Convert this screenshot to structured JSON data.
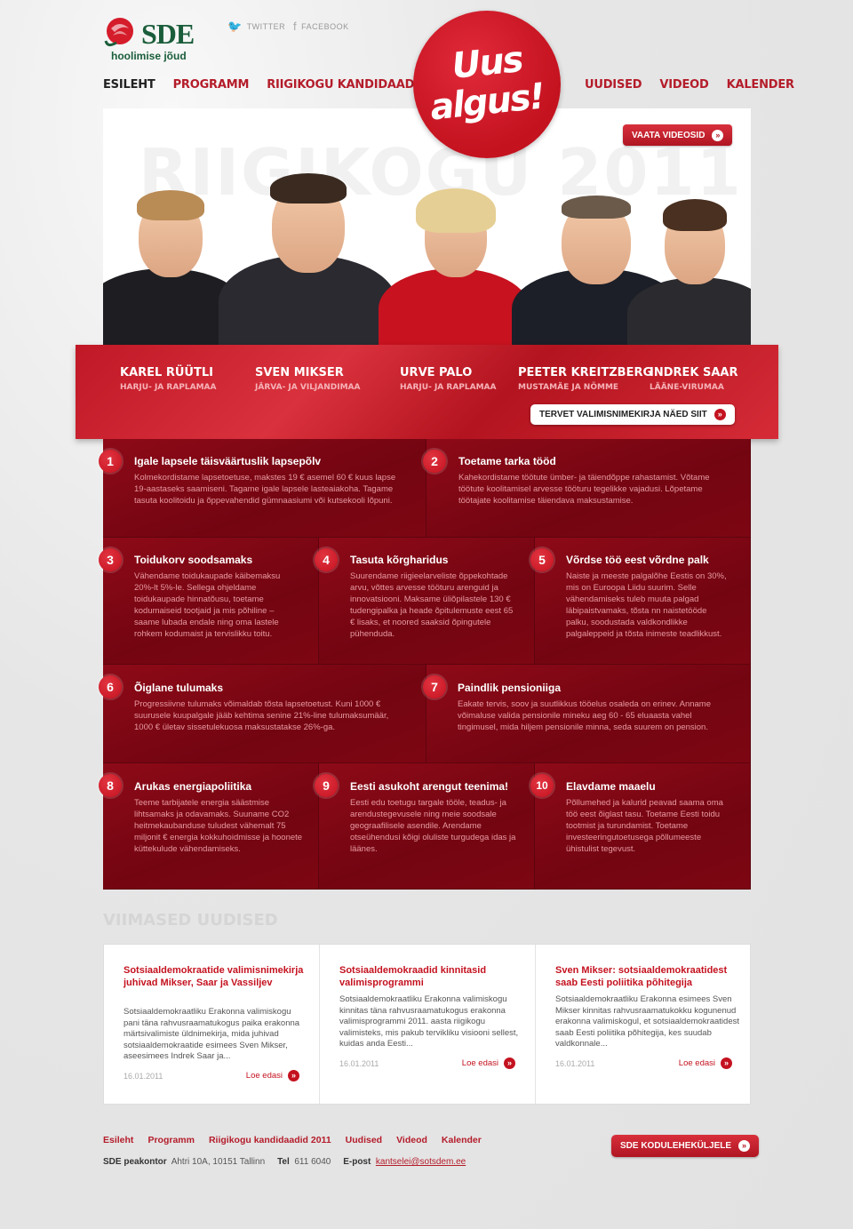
{
  "logo": {
    "brand": "SDE",
    "tagline": "hoolimise jõud"
  },
  "social": {
    "twitter": "TWITTER",
    "facebook": "FACEBOOK"
  },
  "nav_left": [
    "ESILEHT",
    "PROGRAMM",
    "RIIGIKOGU KANDIDAADID 2011"
  ],
  "nav_right": [
    "UUDISED",
    "VIDEOD",
    "KALENDER"
  ],
  "badge": {
    "line1": "Uus",
    "line2": "algus!"
  },
  "hero": {
    "bg_text": "RIIGIKOGU 2011",
    "videos_button": "VAATA VIDEOSID"
  },
  "candidates": [
    {
      "name": "KAREL RÜÜTLI",
      "region": "HARJU- JA RAPLAMAA"
    },
    {
      "name": "SVEN MIKSER",
      "region": "JÄRVA- JA VILJANDIMAA"
    },
    {
      "name": "URVE PALO",
      "region": "HARJU- JA RAPLAMAA"
    },
    {
      "name": "PEETER KREITZBERG",
      "region": "MUSTAMÄE JA NÕMME"
    },
    {
      "name": "INDREK SAAR",
      "region": "LÄÄNE-VIRUMAA"
    }
  ],
  "list_button": "TERVET VALIMISNIMEKIRJA NÄED SIIT",
  "program": [
    {
      "n": "1",
      "title": "Igale lapsele täisväärtuslik lapsepõlv",
      "text": "Kolmekordistame lapsetoetuse, makstes 19 € asemel 60 € kuus lapse 19-aastaseks saamiseni. Tagame igale lapsele lasteaiakoha. Tagame tasuta koolitoidu ja õppevahendid gümnaasiumi või kutsekooli lõpuni."
    },
    {
      "n": "2",
      "title": "Toetame tarka tööd",
      "text": "Kahekordistame töötute ümber- ja täiendõppe rahastamist. Võtame töötute koolitamisel arvesse tööturu tegelikke vajadusi. Lõpetame töötajate koolitamise täiendava maksustamise."
    },
    {
      "n": "3",
      "title": "Toidukorv soodsamaks",
      "text": "Vähendame toidukaupade käibemaksu 20%-lt 5%-le. Sellega ohjeldame toidukaupade hinnatõusu, toetame kodumaiseid tootjaid ja mis põhiline – saame lubada endale ning oma lastele rohkem kodumaist ja tervislikku toitu."
    },
    {
      "n": "4",
      "title": "Tasuta kõrgharidus",
      "text": "Suurendame riigieelarveliste õppekohtade arvu, võttes arvesse tööturu arenguid ja innovatsiooni. Maksame üliõpilastele 130 € tudengipalka ja heade õpitulemuste eest 65 € lisaks, et noored saaksid õpingutele pühenduda."
    },
    {
      "n": "5",
      "title": "Võrdse töö eest võrdne palk",
      "text": "Naiste ja meeste palgalõhe Eestis on 30%, mis on Euroopa Liidu suurim. Selle vähendamiseks tuleb muuta palgad läbipaistvamaks, tõsta nn naistetööde palku, soodustada valdkondlikke palgaleppeid ja tõsta inimeste teadlikkust."
    },
    {
      "n": "6",
      "title": "Õiglane tulumaks",
      "text": "Progressiivne tulumaks võimaldab tõsta lapsetoetust. Kuni 1000 € suurusele kuupalgale jääb kehtima senine 21%-line tulumaksumäär, 1000 € ületav sissetulekuosa maksustatakse 26%-ga."
    },
    {
      "n": "7",
      "title": "Paindlik pensioniiga",
      "text": "Eakate tervis, soov ja suutlikkus tööelus osaleda on erinev. Anname võimaluse valida pensionile mineku aeg 60 - 65 eluaasta vahel tingimusel, mida hiljem pensionile minna, seda suurem on pension."
    },
    {
      "n": "8",
      "title": "Arukas energiapoliitika",
      "text": "Teeme tarbijatele energia säästmise lihtsamaks ja odavamaks. Suuname CO2 heitmekaubanduse tuludest vähemalt 75 miljonit € energia kokkuhoidmisse ja hoonete küttekulude vähendamiseks."
    },
    {
      "n": "9",
      "title": "Eesti asukoht arengut teenima!",
      "text": "Eesti edu toetugu targale tööle, teadus- ja arendustegevusele ning meie soodsale geograafilisele asendile. Arendame otseühendusi kõigi oluliste turgudega idas ja läänes."
    },
    {
      "n": "10",
      "title": "Elavdame maaelu",
      "text": "Põllumehed ja kalurid peavad saama oma töö eest õiglast tasu. Toetame Eesti toidu tootmist ja turundamist. Toetame investeeringutoetusega põllumeeste ühistulist tegevust."
    }
  ],
  "news_heading": "VIIMASED UUDISED",
  "news": [
    {
      "title": "Sotsiaaldemokraatide valimisnimekirja juhivad Mikser, Saar ja Vassiljev",
      "text": "Sotsiaaldemokraatliku Erakonna valimiskogu pani täna rahvusraamatukogus paika erakonna märtsivalimiste üldnimekirja, mida juhivad sotsiaaldemokraatide esimees Sven Mikser, aseesimees Indrek Saar ja...",
      "date": "16.01.2011",
      "more": "Loe edasi"
    },
    {
      "title": "Sotsiaaldemokraadid kinnitasid valimisprogrammi",
      "text": "Sotsiaaldemokraatliku Erakonna valimiskogu kinnitas täna rahvusraamatukogus erakonna valimisprogrammi 2011. aasta riigikogu valimisteks, mis pakub tervikliku visiooni sellest, kuidas anda Eesti...",
      "date": "16.01.2011",
      "more": "Loe edasi"
    },
    {
      "title": "Sven Mikser: sotsiaaldemokraatidest saab Eesti poliitika põhitegija",
      "text": "Sotsiaaldemokraatliku Erakonna esimees Sven Mikser kinnitas rahvusraamatukokku kogunenud erakonna valimiskogul, et sotsiaaldemokraatidest saab Eesti poliitika põhitegija, kes suudab valdkonnale...",
      "date": "16.01.2011",
      "more": "Loe edasi"
    }
  ],
  "footer": {
    "nav": [
      "Esileht",
      "Programm",
      "Riigikogu kandidaadid 2011",
      "Uudised",
      "Videod",
      "Kalender"
    ],
    "office_label": "SDE peakontor",
    "address": "Ahtri 10A, 10151 Tallinn",
    "tel_label": "Tel",
    "tel": "611 6040",
    "email_label": "E-post",
    "email": "kantselei@sotsdem.ee",
    "home_button": "SDE KODULEHEKÜLJELE"
  },
  "colors": {
    "brand_red": "#c4121f",
    "brand_green": "#1a5d3a",
    "program_bg": "#7c0613"
  }
}
